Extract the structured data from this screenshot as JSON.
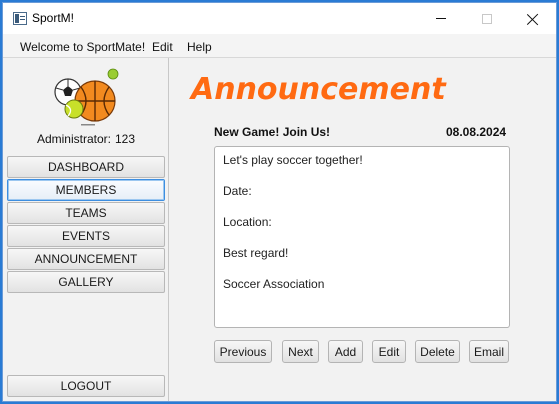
{
  "window": {
    "title": "SportM!"
  },
  "menu": {
    "items": [
      "Welcome to SportMate!",
      "Edit",
      "Help"
    ]
  },
  "sidebar": {
    "logo_icon": "sports-balls-logo-icon",
    "admin_label": "Administrator:",
    "admin_id": "123",
    "nav": [
      {
        "label": "DASHBOARD",
        "focused": false
      },
      {
        "label": "MEMBERS",
        "focused": true
      },
      {
        "label": "TEAMS",
        "focused": false
      },
      {
        "label": "EVENTS",
        "focused": false
      },
      {
        "label": "ANNOUNCEMENT",
        "focused": false
      },
      {
        "label": "GALLERY",
        "focused": false
      }
    ],
    "logout_label": "LOGOUT"
  },
  "main": {
    "heading": "Announcement",
    "heading_color": "#ff6a12",
    "announcement": {
      "title": "New Game! Join Us!",
      "date": "08.08.2024",
      "body_lines": [
        "Let's play soccer together!",
        "Date:",
        "Location:",
        "Best regard!",
        "Soccer Association"
      ]
    },
    "actions": [
      "Previous",
      "Next",
      "Add",
      "Edit",
      "Delete",
      "Email"
    ]
  }
}
